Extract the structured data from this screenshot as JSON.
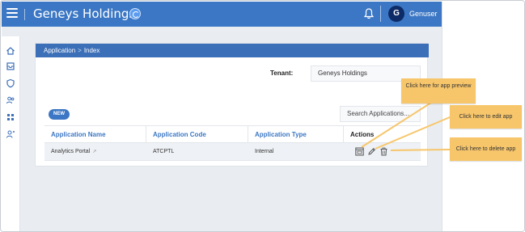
{
  "header": {
    "title": "Geneys Holdings",
    "user_initial": "G",
    "user_name": "Genuser"
  },
  "sidebar": {
    "icons": [
      "home-icon",
      "inbox-icon",
      "shield-icon",
      "users-icon",
      "grid-icon",
      "user-admin-icon"
    ]
  },
  "breadcrumb": {
    "root": "Application",
    "separator": ">",
    "current": "Index"
  },
  "tenant": {
    "label": "Tenant:",
    "value": "Geneys Holdings"
  },
  "toolbar": {
    "new_label": "NEW",
    "search_placeholder": "Search Applications..."
  },
  "table": {
    "headers": [
      "Application Name",
      "Application Code",
      "Application Type",
      "Actions"
    ],
    "rows": [
      {
        "name": "Analytics Portal",
        "code": "ATCPTL",
        "type": "Internal"
      }
    ]
  },
  "callouts": {
    "preview": "Click here for app preview",
    "edit": "Click here to edit app",
    "delete": "Click here to delete app"
  },
  "colors": {
    "primary": "#3b77c4",
    "breadcrumb": "#3b6fb8",
    "callout": "#f7c66b",
    "avatar": "#0d2b66"
  }
}
